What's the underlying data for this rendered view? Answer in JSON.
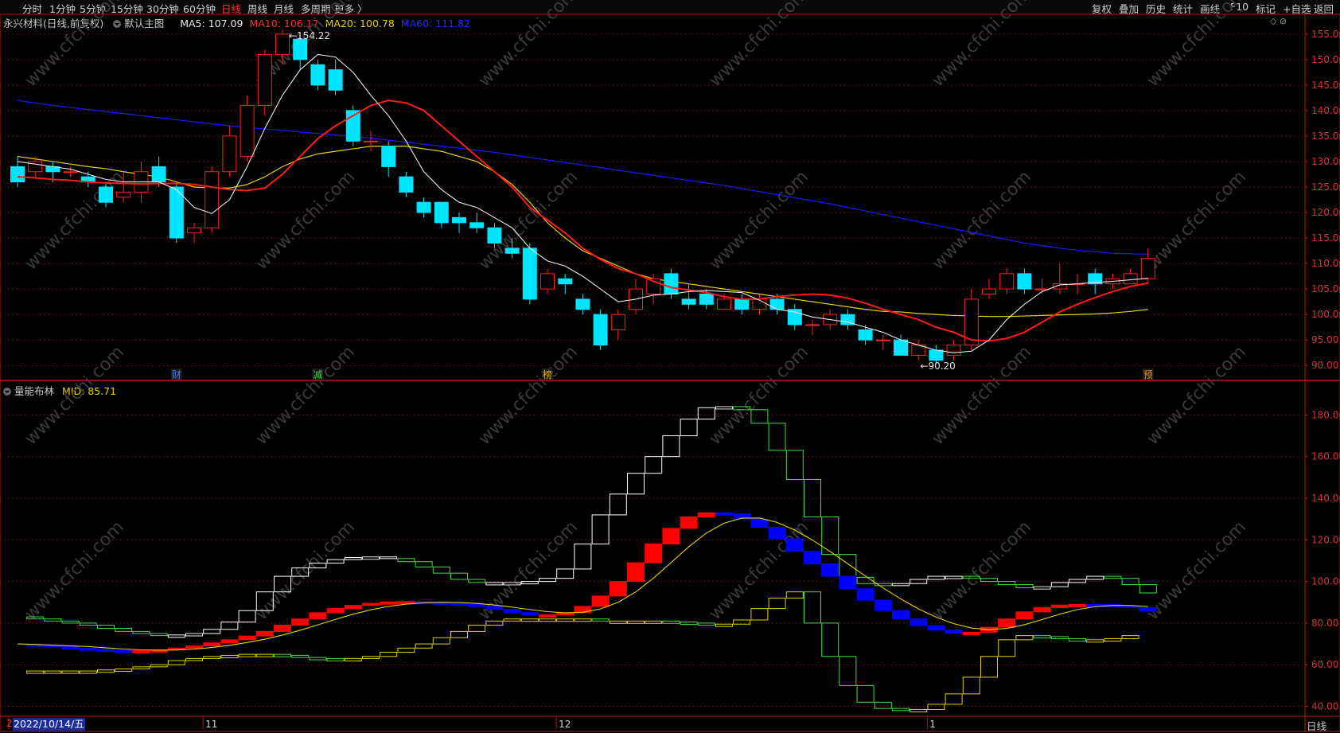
{
  "toolbar": {
    "left": [
      {
        "label": "分时"
      },
      {
        "label": "1分钟"
      },
      {
        "label": "5分钟"
      },
      {
        "label": "15分钟"
      },
      {
        "label": "30分钟"
      },
      {
        "label": "60分钟"
      },
      {
        "label": "日线",
        "active": true
      },
      {
        "label": "周线"
      },
      {
        "label": "月线"
      },
      {
        "label": "多周期"
      },
      {
        "label": "更多 〉"
      }
    ],
    "right": [
      {
        "label": "复权"
      },
      {
        "label": "叠加"
      },
      {
        "label": "历史"
      },
      {
        "label": "统计"
      },
      {
        "label": "画线"
      },
      {
        "label": "F10"
      },
      {
        "label": "标记"
      },
      {
        "label": "+自选"
      },
      {
        "label": "返回"
      }
    ]
  },
  "main_panel": {
    "stock_title": "永兴材料(日线,前复权)",
    "template": "默认主图",
    "ma": [
      {
        "label": "MA5: 107.09",
        "color": "#e8e8e8"
      },
      {
        "label": "MA10: 106.17",
        "color": "#ff3030"
      },
      {
        "label": "MA20: 100.78",
        "color": "#e6d200"
      },
      {
        "label": "MA60: 111.82",
        "color": "#2a2aff"
      }
    ],
    "high_label": "154.22",
    "low_label": "90.20",
    "event_markers": [
      {
        "text": "财",
        "color": "#4a7bff"
      },
      {
        "text": "减",
        "color": "#44cc44"
      },
      {
        "text": "榜",
        "color": "#e6b400"
      },
      {
        "text": "预",
        "color": "#ff8c00"
      }
    ]
  },
  "sub_panel": {
    "indicator": "量能布林",
    "mid_label": "MID: 85.71"
  },
  "window_icons": "◇ ⊘",
  "bottom": {
    "date": "2022/10/14/五",
    "date_prefix": "2",
    "month_labels": [
      "11",
      "12",
      "1"
    ],
    "period": "日线"
  },
  "watermark": "www.cfchi.com",
  "colors": {
    "up": "#ff2020",
    "down": "#00e5ff",
    "ma5": "#e8e8e8",
    "ma10": "#ff1a1a",
    "ma20": "#e6d200",
    "ma60": "#1a1aff",
    "axis": "#c0141e",
    "grid": "#5a0f14"
  },
  "chart_data": [
    {
      "type": "candlestick",
      "title": "永兴材料(日线,前复权)",
      "y_ticks": [
        155,
        150,
        145,
        140,
        135,
        130,
        125,
        120,
        115,
        110,
        105,
        100,
        95,
        90
      ],
      "ylim": [
        88,
        157
      ],
      "candles": [
        [
          129,
          126,
          131,
          125
        ],
        [
          128,
          130,
          131,
          127
        ],
        [
          129,
          128,
          130,
          126
        ],
        [
          128,
          128,
          129,
          127
        ],
        [
          127,
          126,
          128,
          125
        ],
        [
          125,
          122,
          126,
          121
        ],
        [
          123,
          124,
          128,
          122
        ],
        [
          124,
          128,
          130,
          122
        ],
        [
          129,
          126,
          131,
          125
        ],
        [
          125,
          115,
          126,
          114
        ],
        [
          116,
          117,
          118,
          114
        ],
        [
          117,
          128,
          129,
          116
        ],
        [
          128,
          135,
          137,
          127
        ],
        [
          131,
          141,
          143,
          130
        ],
        [
          141,
          151,
          152,
          139
        ],
        [
          151,
          155,
          156,
          149
        ],
        [
          154,
          150,
          155,
          148
        ],
        [
          149,
          145,
          150,
          144
        ],
        [
          148,
          144,
          150,
          143
        ],
        [
          140,
          134,
          141,
          133
        ],
        [
          134,
          134,
          136,
          132
        ],
        [
          133,
          129,
          134,
          127
        ],
        [
          127,
          124,
          128,
          123
        ],
        [
          122,
          120,
          123,
          119
        ],
        [
          122,
          118,
          122,
          117
        ],
        [
          119,
          118,
          120,
          116
        ],
        [
          118,
          117,
          120,
          116
        ],
        [
          117,
          114,
          118,
          113
        ],
        [
          113,
          112,
          115,
          111
        ],
        [
          113,
          103,
          114,
          102
        ],
        [
          105,
          108,
          109,
          104
        ],
        [
          107,
          106,
          108,
          104
        ],
        [
          103,
          101,
          104,
          100
        ],
        [
          100,
          94,
          101,
          93
        ],
        [
          97,
          100,
          101,
          95
        ],
        [
          101,
          105,
          107,
          100
        ],
        [
          104,
          107,
          108,
          102
        ],
        [
          108,
          104,
          109,
          103
        ],
        [
          103,
          102,
          106,
          101
        ],
        [
          104,
          102,
          105,
          101
        ],
        [
          101,
          103,
          104,
          101
        ],
        [
          103,
          101,
          104,
          100
        ],
        [
          101,
          103,
          104,
          100
        ],
        [
          103,
          101,
          104,
          100
        ],
        [
          101,
          98,
          102,
          97
        ],
        [
          98,
          98,
          99,
          96
        ],
        [
          98,
          100,
          101,
          97
        ],
        [
          100,
          98,
          101,
          97
        ],
        [
          97,
          95,
          98,
          94
        ],
        [
          95,
          95,
          96,
          93
        ],
        [
          95,
          92,
          96,
          92
        ],
        [
          92,
          94,
          95,
          91
        ],
        [
          93,
          91,
          94,
          90.2
        ],
        [
          92,
          94,
          95,
          91
        ],
        [
          94,
          103,
          105,
          93
        ],
        [
          104,
          105,
          107,
          103
        ],
        [
          105,
          108,
          109,
          104
        ],
        [
          108,
          105,
          109,
          104
        ],
        [
          105,
          105,
          107,
          104
        ],
        [
          105,
          106,
          110,
          104
        ],
        [
          106,
          106,
          108,
          104
        ],
        [
          108,
          106,
          109,
          104
        ],
        [
          106,
          107,
          108,
          105
        ],
        [
          106,
          108,
          109,
          106
        ],
        [
          107,
          111,
          113,
          106
        ]
      ],
      "ma5": [
        130,
        129.5,
        129,
        128.5,
        127.5,
        126.5,
        126,
        126,
        126,
        124.5,
        121,
        119.8,
        122.5,
        129,
        136.5,
        143,
        148,
        151,
        150.5,
        147.5,
        143,
        139,
        134,
        128,
        124.5,
        122,
        121,
        119,
        117,
        113,
        110.5,
        109.5,
        107.5,
        105,
        102.5,
        103,
        103.8,
        104,
        104.5,
        104.7,
        104.5,
        104.3,
        102.8,
        101,
        100.5,
        99.5,
        99,
        98.5,
        97.5,
        96.5,
        95,
        94,
        93,
        92.5,
        92.8,
        95,
        99,
        102,
        104.5,
        105.8,
        106,
        106.3,
        106.5,
        106.8,
        107.09
      ],
      "ma10": [
        127,
        126.8,
        126.5,
        126.3,
        126,
        125.8,
        125.7,
        125.6,
        125.7,
        125.7,
        125.5,
        125,
        124.5,
        124.3,
        124.8,
        127.5,
        131,
        134.5,
        137,
        139,
        141,
        142,
        141.5,
        140,
        137,
        134,
        131,
        128,
        125,
        121,
        118.5,
        116,
        113,
        110.8,
        109,
        108,
        106.5,
        105.3,
        104.8,
        104.3,
        103.5,
        103,
        103,
        103.5,
        103.8,
        104,
        103.8,
        103.2,
        102.2,
        101,
        100,
        99,
        97.5,
        96.5,
        95,
        94.8,
        95.3,
        96.5,
        98.5,
        100.5,
        102,
        103.3,
        104.5,
        105.5,
        106.17
      ],
      "ma20": [
        131,
        130.5,
        130,
        129.5,
        129,
        128.6,
        128,
        127.5,
        127,
        126,
        125,
        124.8,
        124.8,
        125.5,
        127,
        129,
        130.5,
        131.5,
        132,
        132.5,
        133,
        133,
        133,
        132.5,
        132,
        131,
        130,
        128,
        125.5,
        122,
        118,
        115,
        112.5,
        111,
        109.5,
        108,
        107,
        106.5,
        106,
        105.5,
        105,
        104.5,
        104,
        103.5,
        103,
        102.5,
        102,
        101.5,
        101,
        100.6,
        100.5,
        100.2,
        100,
        99.8,
        99.7,
        99.6,
        99.6,
        99.7,
        99.8,
        99.9,
        100,
        100.1,
        100.3,
        100.6,
        101
      ],
      "ma60": [
        142,
        141.5,
        141,
        140.6,
        140.2,
        139.8,
        139.4,
        139,
        138.6,
        138.2,
        137.8,
        137.4,
        137,
        136.7,
        136.4,
        136.1,
        135.8,
        135.5,
        135.2,
        134.9,
        134.6,
        134.2,
        133.8,
        133.4,
        133,
        132.6,
        132.2,
        131.8,
        131.3,
        130.8,
        130.3,
        129.8,
        129.3,
        128.8,
        128.3,
        127.8,
        127.3,
        126.8,
        126.3,
        125.8,
        125.3,
        124.7,
        124.1,
        123.5,
        122.9,
        122.3,
        121.7,
        121,
        120.3,
        119.6,
        118.9,
        118.2,
        117.5,
        116.8,
        116.1,
        115.4,
        114.7,
        114,
        113.5,
        113,
        112.6,
        112.3,
        112,
        111.9,
        111.82
      ]
    },
    {
      "type": "line",
      "title": "量能布林",
      "y_ticks": [
        180,
        160,
        140,
        120,
        100,
        80,
        60,
        40
      ],
      "ylim": [
        36,
        192
      ],
      "mid": [
        70,
        69.5,
        68.7,
        68,
        67.5,
        67,
        66.5,
        66.8,
        67.2,
        68,
        69,
        70.5,
        72,
        73.8,
        76,
        79,
        82,
        85,
        87,
        88.5,
        89.5,
        90.2,
        90.4,
        90.2,
        89.7,
        89,
        88,
        86.6,
        85,
        84,
        84,
        85,
        88,
        93,
        100,
        109,
        118,
        125.5,
        131,
        133,
        132.5,
        130,
        126,
        120.5,
        114.5,
        108.5,
        102.5,
        96.5,
        91,
        86,
        82,
        78.8,
        76.6,
        75.2,
        75.6,
        78,
        82,
        85.4,
        87.5,
        88.7,
        89,
        88.9,
        88.4,
        87.5,
        85.71
      ],
      "upper": [
        83,
        82,
        81,
        80,
        79,
        77.5,
        76,
        75,
        74,
        74.3,
        75,
        77,
        80.5,
        86,
        95,
        102.5,
        106.5,
        108.8,
        110.5,
        111.5,
        111.8,
        111,
        109.5,
        107,
        104,
        101,
        99.5,
        99.3,
        99.5,
        100,
        101.5,
        106,
        118,
        132,
        142,
        152,
        160,
        170,
        178,
        183.5,
        184,
        182.5,
        176,
        163,
        149,
        131,
        113,
        102,
        99,
        98,
        99,
        101,
        102.5,
        102.5,
        101.5,
        100,
        98.5,
        97,
        97.5,
        99.5,
        101,
        102.5,
        101.5,
        98.5,
        94.5
      ],
      "lower": [
        57,
        57,
        57,
        57,
        57,
        57.5,
        58,
        59,
        60,
        62,
        63,
        64,
        64.5,
        65,
        65,
        64.5,
        63.5,
        63,
        62.8,
        63,
        64,
        66,
        68,
        70,
        73,
        76,
        79,
        81,
        82,
        82,
        82,
        82,
        82,
        81,
        81,
        81,
        81,
        80.5,
        80,
        79,
        79.5,
        81.5,
        87,
        92,
        95,
        80,
        64,
        50,
        42,
        39,
        38,
        38.5,
        41,
        46,
        54,
        64,
        72,
        74,
        73.5,
        72.5,
        72,
        72,
        72.5,
        74
      ]
    }
  ]
}
